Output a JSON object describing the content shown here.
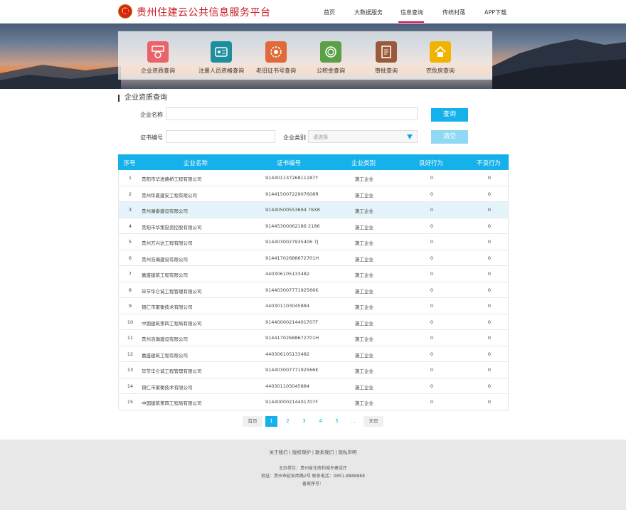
{
  "header": {
    "title": "贵州住建云公共信息服务平台",
    "nav": [
      "首页",
      "大数据服务",
      "信息查询",
      "传统村落",
      "APP下载"
    ],
    "active_nav": "信息查询"
  },
  "quick_links": [
    {
      "label": "企业资质查询",
      "icon": "building-certificate-icon",
      "color": "#e9636a"
    },
    {
      "label": "注册人员资格查询",
      "icon": "id-card-icon",
      "color": "#1e8e9e"
    },
    {
      "label": "老旧证书号查询",
      "icon": "gear-certificate-icon",
      "color": "#e06a3a"
    },
    {
      "label": "公积金查询",
      "icon": "coin-icon",
      "color": "#5aa046"
    },
    {
      "label": "审批查询",
      "icon": "document-stamp-icon",
      "color": "#9a5a3a"
    },
    {
      "label": "农危房查询",
      "icon": "house-icon",
      "color": "#f0b400"
    }
  ],
  "section": {
    "title": "企业资质查询"
  },
  "form": {
    "company_name_label": "企业名称",
    "cert_no_label": "证书编号",
    "category_label": "企业类别",
    "category_placeholder": "请选择",
    "query_button": "查询",
    "clear_button": "清空"
  },
  "table": {
    "headers": [
      "序号",
      "企业名称",
      "证书编号",
      "企业类别",
      "良好行为",
      "不良行为"
    ],
    "rows": [
      [
        "1",
        "贵阳市华进路桥工程有限公司",
        "91440113726811187Y",
        "施工企业",
        "0",
        "0"
      ],
      [
        "2",
        "贵州华夏建安工程有限公司",
        "91441500722907608R",
        "施工企业",
        "0",
        "0"
      ],
      [
        "3",
        "贵州澜泰建设有限公司",
        "91440500553694 76X8",
        "施工企业",
        "0",
        "0"
      ],
      [
        "4",
        "贵阳市华策投资控股有限公司",
        "91445300062186 2186",
        "施工企业",
        "0",
        "0"
      ],
      [
        "5",
        "贵州方兴达工程有限公司",
        "9144030027935406 7J",
        "施工企业",
        "0",
        "0"
      ],
      [
        "6",
        "贵州浩瀚建设有限公司",
        "91441702688672701H",
        "施工企业",
        "0",
        "0"
      ],
      [
        "7",
        "嘉盛建筑工程有限公司",
        "440306105133482",
        "施工企业",
        "0",
        "0"
      ],
      [
        "8",
        "毕节华仑诚工程管理有限公司",
        "91440300777192566K",
        "施工企业",
        "0",
        "0"
      ],
      [
        "9",
        "铜仁市聚衡技术有限公司",
        "440301103045884",
        "施工企业",
        "0",
        "0"
      ],
      [
        "10",
        "中国建筑第四工程局有限公司",
        "91440000214401707F",
        "施工企业",
        "0",
        "0"
      ],
      [
        "11",
        "贵州浩瀚建设有限公司",
        "91441702688672701H",
        "施工企业",
        "0",
        "0"
      ],
      [
        "12",
        "嘉盛建筑工程有限公司",
        "440306105133482",
        "施工企业",
        "0",
        "0"
      ],
      [
        "13",
        "毕节华仑诚工程管理有限公司",
        "91440300777192566K",
        "施工企业",
        "0",
        "0"
      ],
      [
        "14",
        "铜仁市聚衡技术有限公司",
        "440301103045884",
        "施工企业",
        "0",
        "0"
      ],
      [
        "15",
        "中国建筑第四工程局有限公司",
        "91440000214401707F",
        "施工企业",
        "0",
        "0"
      ]
    ],
    "highlight_row": 3
  },
  "pagination": {
    "first": "首页",
    "pages": [
      "1",
      "2",
      "3",
      "4",
      "5"
    ],
    "ellipsis": "...",
    "last": "末页",
    "current": "1"
  },
  "footer": {
    "links": [
      "关于我们",
      "版权保护",
      "联系我们",
      "隐私声明"
    ],
    "sponsor": "主办单位：贵州省住房和城乡建设厅",
    "address": "地址：贵州市延安西路2号  联系电话：0851-8888888",
    "icp": "备案序号："
  }
}
